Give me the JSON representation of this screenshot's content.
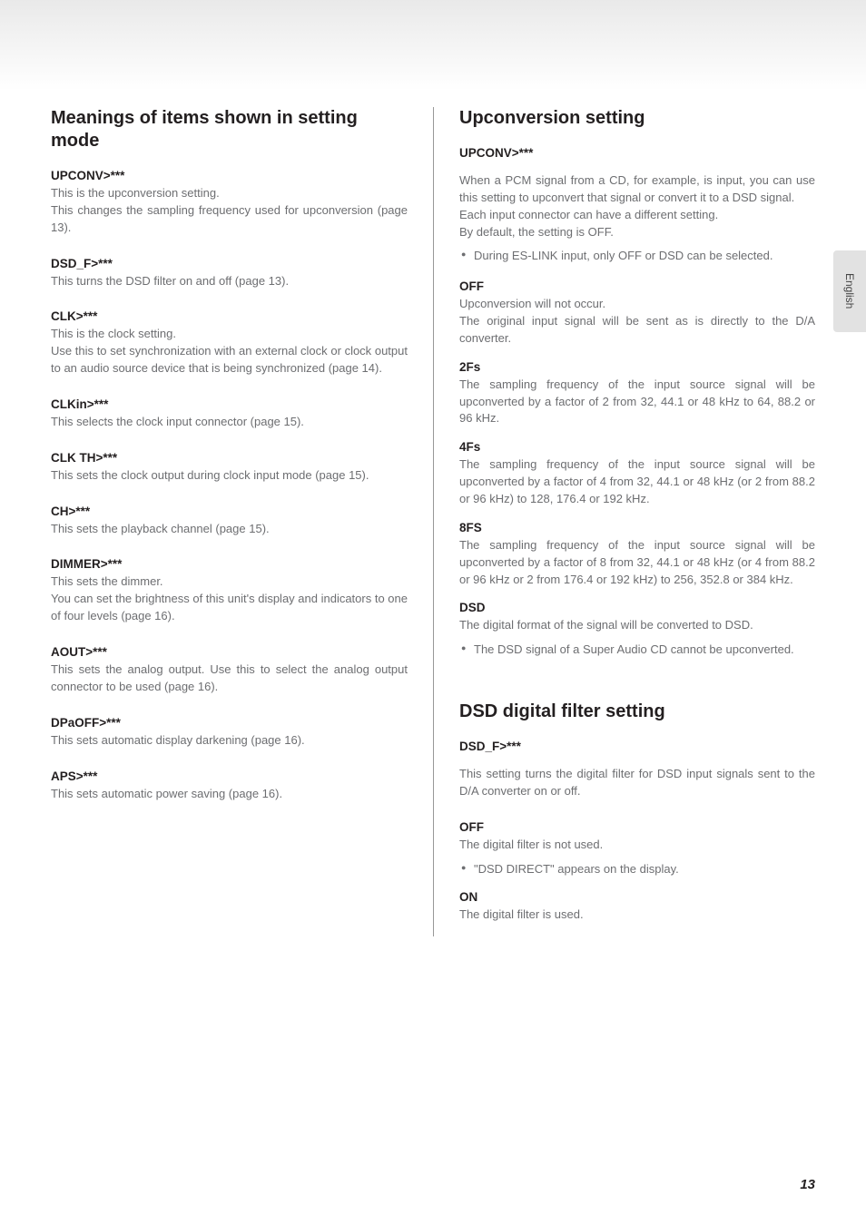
{
  "language_tab": "English",
  "page_number": "13",
  "left": {
    "heading": "Meanings of items shown in setting mode",
    "items": [
      {
        "title": "UPCONV>***",
        "lines": [
          "This is the upconversion setting.",
          "This changes the sampling frequency used for upconversion (page 13)."
        ]
      },
      {
        "title": "DSD_F>***",
        "lines": [
          "This turns the DSD filter on and off (page 13)."
        ]
      },
      {
        "title": "CLK>***",
        "lines": [
          "This is the clock setting.",
          "Use this to set synchronization with an external clock or clock output to an audio source device that is being synchronized (page 14)."
        ]
      },
      {
        "title": "CLKin>***",
        "lines": [
          "This selects the clock input connector (page 15)."
        ]
      },
      {
        "title": "CLK TH>***",
        "lines": [
          "This sets the clock output during clock input mode (page 15)."
        ]
      },
      {
        "title": "CH>***",
        "lines": [
          "This sets the playback channel (page 15)."
        ]
      },
      {
        "title": "DIMMER>***",
        "lines": [
          "This sets the dimmer.",
          "You can set the brightness of this unit's display and indicators to one of four levels (page 16)."
        ]
      },
      {
        "title": "AOUT>***",
        "lines": [
          "This sets the analog output. Use this to select the analog output connector to be used (page 16)."
        ]
      },
      {
        "title": "DPaOFF>***",
        "lines": [
          "This sets automatic display darkening (page 16)."
        ]
      },
      {
        "title": "APS>***",
        "lines": [
          "This sets automatic power saving (page 16)."
        ]
      }
    ]
  },
  "right": {
    "section1": {
      "heading": "Upconversion setting",
      "subhead": "UPCONV>***",
      "intro": [
        "When a PCM signal from a CD, for example, is input, you can use this setting to upconvert that signal or convert it to a DSD signal.",
        "Each input connector can have a different setting.",
        "By default, the setting is OFF."
      ],
      "intro_bullet": "During ES-LINK input, only OFF or DSD can be selected.",
      "options": [
        {
          "title": "OFF",
          "lines": [
            "Upconversion will not occur.",
            "The original input signal will be sent as is directly to the D/A converter."
          ]
        },
        {
          "title": "2Fs",
          "lines": [
            "The sampling frequency of the input source signal will be upconverted by a factor of 2 from 32, 44.1 or 48 kHz to 64, 88.2 or 96 kHz."
          ]
        },
        {
          "title": "4Fs",
          "lines": [
            "The sampling frequency of the input source signal will be upconverted by a factor of 4 from 32, 44.1 or 48 kHz (or 2 from 88.2 or 96 kHz) to 128, 176.4 or 192 kHz."
          ]
        },
        {
          "title": "8FS",
          "lines": [
            "The sampling frequency of the input source signal will be upconverted by a factor of 8 from 32, 44.1 or 48 kHz (or 4 from 88.2 or 96 kHz or 2 from 176.4 or 192 kHz) to 256, 352.8 or 384 kHz."
          ]
        },
        {
          "title": "DSD",
          "lines": [
            "The digital format of the signal will be converted to DSD."
          ],
          "bullet": "The DSD signal of a Super Audio CD cannot be upconverted."
        }
      ]
    },
    "section2": {
      "heading": "DSD digital filter setting",
      "subhead": "DSD_F>***",
      "intro": [
        "This setting turns the digital filter for DSD input signals sent to the D/A converter on or off."
      ],
      "options": [
        {
          "title": "OFF",
          "lines": [
            "The digital filter is not used."
          ],
          "bullet": "\"DSD DIRECT\" appears on the display."
        },
        {
          "title": "ON",
          "lines": [
            "The digital filter is used."
          ]
        }
      ]
    }
  }
}
